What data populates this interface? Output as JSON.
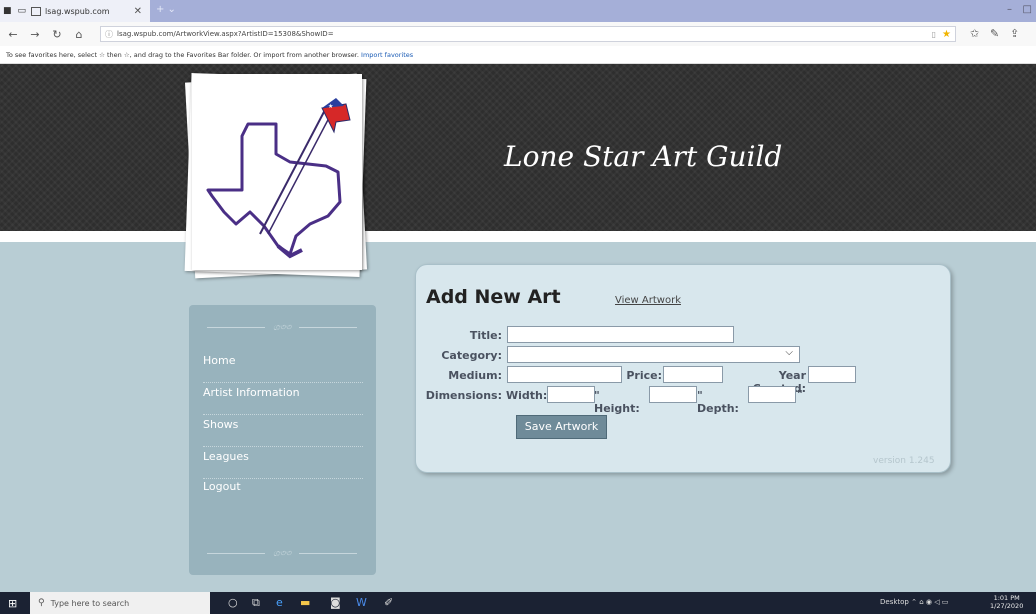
{
  "browser": {
    "tab_title": "lsag.wspub.com",
    "url": "lsag.wspub.com/ArtworkView.aspx?ArtistID=15308&ShowID=",
    "favorites_text": "To see favorites here, select ☆ then ☆, and drag to the Favorites Bar folder. Or import from another browser.",
    "favorites_link": "Import favorites"
  },
  "header": {
    "site_title": "Lone Star Art Guild"
  },
  "sidebar": {
    "items": [
      {
        "label": "Home"
      },
      {
        "label": "Artist Information"
      },
      {
        "label": "Shows"
      },
      {
        "label": "Leagues"
      },
      {
        "label": "Logout"
      }
    ]
  },
  "form": {
    "heading": "Add New Art",
    "view_link": "View Artwork",
    "labels": {
      "title": "Title:",
      "category": "Category:",
      "medium": "Medium:",
      "price": "Price:",
      "year_created": "Year Created:",
      "dimensions": "Dimensions:",
      "width": "Width:",
      "height": "\" Height:",
      "depth": "\" Depth:",
      "inch_mark": "\""
    },
    "values": {
      "title": "",
      "category": "",
      "medium": "",
      "price": "",
      "year_created": "",
      "width": "",
      "height": "",
      "depth": ""
    },
    "save_label": "Save Artwork",
    "version": "version 1.245"
  },
  "taskbar": {
    "search_placeholder": "Type here to search",
    "desktop_label": "Desktop",
    "time": "1:01 PM",
    "date": "1/27/2020"
  },
  "colors": {
    "page_bg": "#b8cdd4",
    "header_bg": "#2e2e2e",
    "card_bg": "#d8e7ed",
    "sidebar_bg": "#98b3bd",
    "button_bg": "#6f8b99"
  }
}
